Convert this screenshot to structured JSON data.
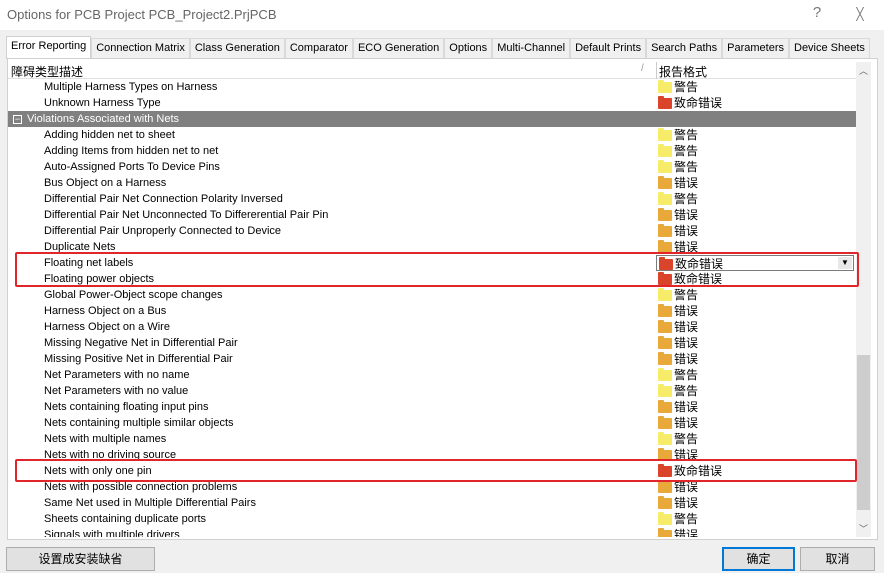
{
  "window": {
    "title": "Options for PCB Project PCB_Project2.PrjPCB",
    "help": "?",
    "close": "╳"
  },
  "tabs": [
    "Error Reporting",
    "Connection Matrix",
    "Class Generation",
    "Comparator",
    "ECO Generation",
    "Options",
    "Multi-Channel",
    "Default Prints",
    "Search Paths",
    "Parameters",
    "Device Sheets"
  ],
  "active_tab": "Error Reporting",
  "table": {
    "col1": "障碍类型描述",
    "col2": "报告格式",
    "sort_indicator": "/"
  },
  "colors": {
    "警告": "#f7ec6a",
    "错误": "#e9a93a",
    "致命错误": "#d9442a",
    "highlight": "#e0262a"
  },
  "rows": [
    {
      "name": "Multiple Harness Types on Harness",
      "level": "警告"
    },
    {
      "name": "Unknown Harness Type",
      "level": "致命错误"
    },
    {
      "name": "Violations Associated with Nets",
      "group": true
    },
    {
      "name": "Adding hidden net to sheet",
      "level": "警告"
    },
    {
      "name": "Adding Items from hidden net to net",
      "level": "警告"
    },
    {
      "name": "Auto-Assigned Ports To Device Pins",
      "level": "警告"
    },
    {
      "name": "Bus Object on a Harness",
      "level": "错误"
    },
    {
      "name": "Differential Pair Net Connection Polarity Inversed",
      "level": "警告"
    },
    {
      "name": "Differential Pair Net Unconnected To Differerential Pair Pin",
      "level": "错误"
    },
    {
      "name": "Differential Pair Unproperly Connected to Device",
      "level": "错误"
    },
    {
      "name": "Duplicate Nets",
      "level": "错误"
    },
    {
      "name": "Floating net labels",
      "level": "致命错误",
      "dropdown": true,
      "highlighted": true
    },
    {
      "name": "Floating power objects",
      "level": "致命错误",
      "highlighted": true
    },
    {
      "name": "Global Power-Object scope changes",
      "level": "警告"
    },
    {
      "name": "Harness Object on a Bus",
      "level": "错误"
    },
    {
      "name": "Harness Object on a Wire",
      "level": "错误"
    },
    {
      "name": "Missing Negative Net in Differential Pair",
      "level": "错误"
    },
    {
      "name": "Missing Positive Net in Differential Pair",
      "level": "错误"
    },
    {
      "name": "Net Parameters with no name",
      "level": "警告"
    },
    {
      "name": "Net Parameters with no value",
      "level": "警告"
    },
    {
      "name": "Nets containing floating input pins",
      "level": "错误"
    },
    {
      "name": "Nets containing multiple similar objects",
      "level": "错误"
    },
    {
      "name": "Nets with multiple names",
      "level": "警告"
    },
    {
      "name": "Nets with no driving source",
      "level": "错误"
    },
    {
      "name": "Nets with only one pin",
      "level": "致命错误",
      "highlighted": true
    },
    {
      "name": "Nets with possible connection problems",
      "level": "错误"
    },
    {
      "name": "Same Net used in Multiple Differential Pairs",
      "level": "错误"
    },
    {
      "name": "Sheets containing duplicate ports",
      "level": "警告"
    },
    {
      "name": "Signals with multiple drivers",
      "level": "错误"
    }
  ],
  "buttons": {
    "defaults": "设置成安装缺省",
    "ok": "确定",
    "cancel": "取消"
  }
}
